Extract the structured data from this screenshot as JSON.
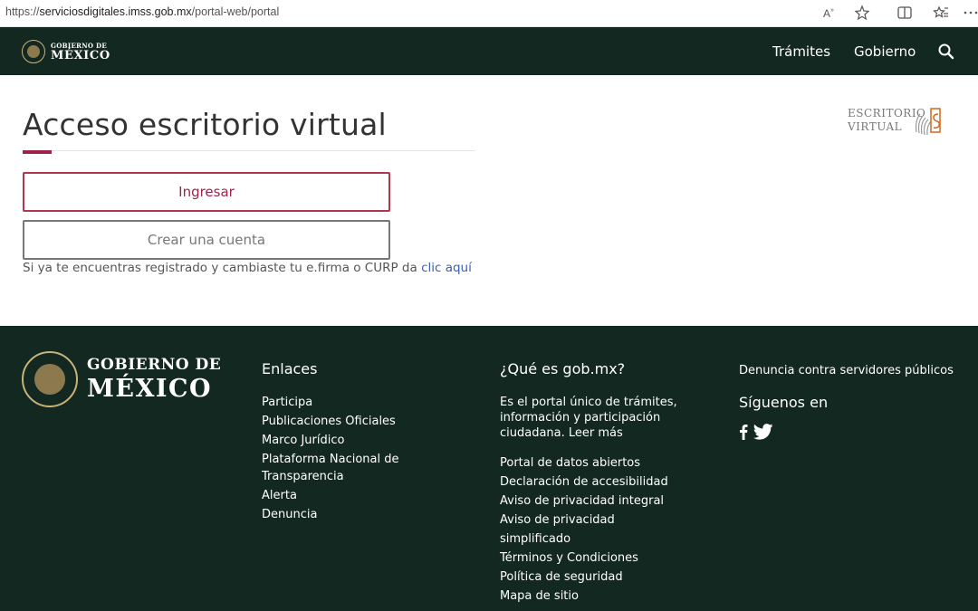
{
  "browser": {
    "url_prefix": "https://",
    "url_host": "serviciosdigitales.imss.gob.mx",
    "url_path": "/portal-web/portal"
  },
  "header": {
    "logo_small": "GOBIERNO DE",
    "logo_big": "MÉXICO",
    "nav": [
      "Trámites",
      "Gobierno"
    ]
  },
  "main": {
    "title": "Acceso escritorio virtual",
    "logo_line1": "ESCRITORIO",
    "logo_line2": "VIRTUAL",
    "login_button": "Ingresar",
    "create_button": "Crear una cuenta",
    "help_text": "Si ya te encuentras registrado y cambiaste tu e.firma o CURP da ",
    "help_link": "clic aquí"
  },
  "footer": {
    "logo_small": "GOBIERNO DE",
    "logo_big": "MÉXICO",
    "links_heading": "Enlaces",
    "links": [
      "Participa",
      "Publicaciones Oficiales",
      "Marco Jurídico",
      "Plataforma Nacional de Transparencia",
      "Alerta",
      "Denuncia"
    ],
    "about_heading": "¿Qué es gob.mx?",
    "about_text": "Es el portal único de trámites, información y participación ciudadana. Leer más",
    "about_links": [
      "Portal de datos abiertos",
      "Declaración de accesibilidad",
      "Aviso de privacidad integral",
      "Aviso de privacidad simplificado",
      "Términos y Condiciones",
      "Política de seguridad",
      "Mapa de sitio"
    ],
    "report_link": "Denuncia contra servidores públicos",
    "follow_heading": "Síguenos en",
    "social": [
      "facebook-icon",
      "twitter-icon"
    ]
  }
}
